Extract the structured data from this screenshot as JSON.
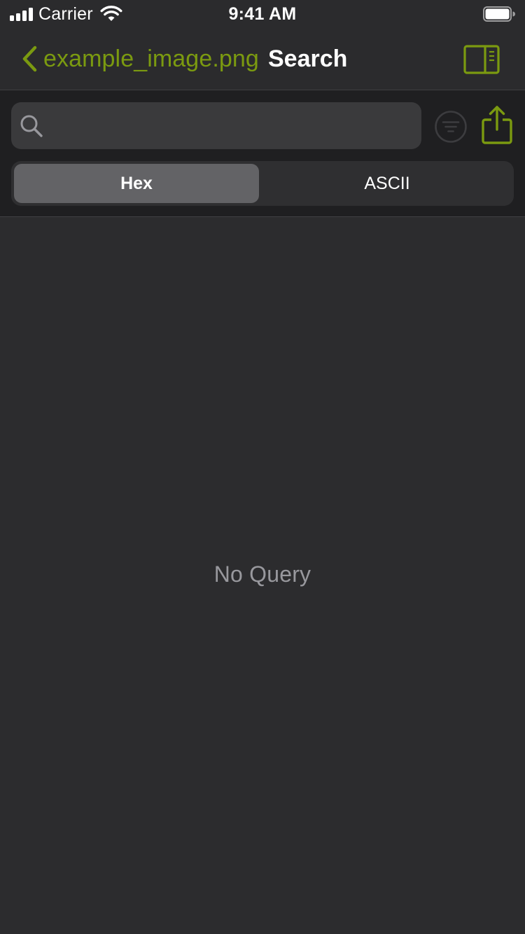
{
  "status_bar": {
    "carrier": "Carrier",
    "time": "9:41 AM",
    "icons": [
      "signal-bars-icon",
      "wifi-icon",
      "battery-icon"
    ]
  },
  "nav_bar": {
    "back_label": "example_image.png",
    "title": "Search",
    "icons": [
      "chevron-left-icon",
      "sidebar-toggle-icon"
    ]
  },
  "search": {
    "placeholder": "",
    "value": "",
    "icons": [
      "search-icon",
      "filter-icon",
      "share-icon"
    ]
  },
  "segmented_control": {
    "options": [
      {
        "label": "Hex",
        "selected": true
      },
      {
        "label": "ASCII",
        "selected": false
      }
    ]
  },
  "content": {
    "empty_message": "No Query"
  },
  "colors": {
    "accent": "#7b9a10",
    "background": "#2c2c2e",
    "bar_background": "#2b2b2d",
    "search_area_background": "#1f1f21",
    "field_background": "#3a3a3c",
    "selected_segment": "#636366",
    "secondary_text": "#98989d"
  }
}
